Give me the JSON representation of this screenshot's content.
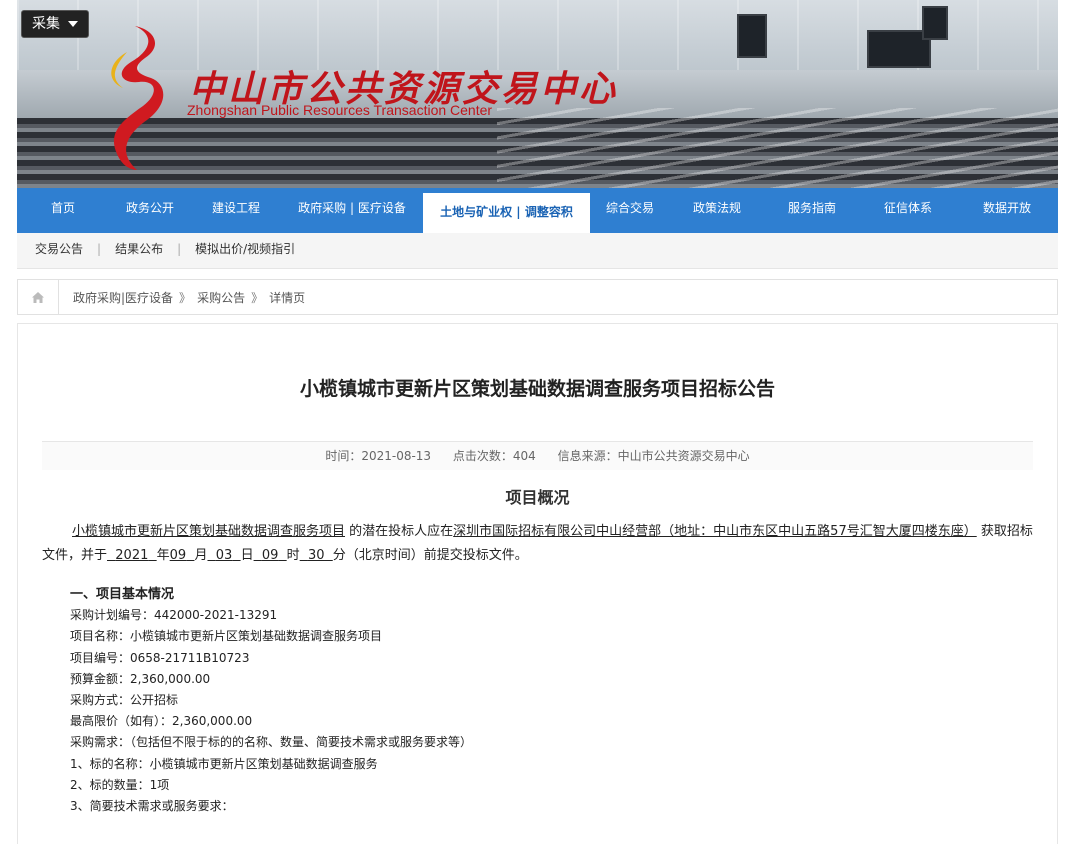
{
  "banner": {
    "collect_label": "采集",
    "logo_cn": "中山市公共资源交易中心",
    "logo_en": "Zhongshan Public Resources Transaction Center"
  },
  "nav": [
    "首页",
    "政务公开",
    "建设工程",
    "政府采购 | 医疗设备",
    "土地与矿业权 | 调整容积",
    "综合交易",
    "政策法规",
    "服务指南",
    "征信体系",
    "数据开放"
  ],
  "nav_active": 4,
  "subnav": [
    "交易公告",
    "结果公布",
    "模拟出价/视频指引"
  ],
  "breadcrumb": [
    "政府采购|医疗设备",
    "采购公告",
    "详情页"
  ],
  "article": {
    "title": "小榄镇城市更新片区策划基础数据调查服务项目招标公告",
    "time": "时间：2021-08-13",
    "clicks": "点击次数：404",
    "source": "信息来源：中山市公共资源交易中心",
    "section_title": "项目概况",
    "intro": {
      "project": "小榄镇城市更新片区策划基础数据调查服务项目",
      "mid1": "的潜在投标人应在",
      "location": "深圳市国际招标有限公司中山经营部（地址：中山市东区中山五路57号汇智大厦四楼东座）",
      "mid2": "获取招标文件，并于",
      "year": "2021",
      "month": "09",
      "day": "03",
      "hour": "09",
      "minute": "30",
      "tail": "分（北京时间）前提交投标文件。"
    },
    "details": [
      "一、项目基本情况",
      "采购计划编号：442000-2021-13291",
      "项目名称：小榄镇城市更新片区策划基础数据调查服务项目",
      "项目编号：0658-21711B10723",
      "预算金额：2,360,000.00",
      "采购方式：公开招标",
      "最高限价（如有）：2,360,000.00",
      "采购需求：（包括但不限于标的的名称、数量、简要技术需求或服务要求等）",
      "1、标的名称：小榄镇城市更新片区策划基础数据调查服务",
      "2、标的数量：1项",
      "3、简要技术需求或服务要求："
    ]
  }
}
